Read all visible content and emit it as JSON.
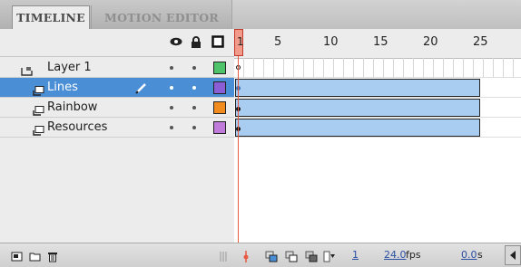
{
  "tabs": [
    {
      "label": "TIMELINE",
      "active": true
    },
    {
      "label": "MOTION EDITOR",
      "active": false
    }
  ],
  "column_icons": [
    "eye-icon",
    "lock-icon",
    "outline-icon"
  ],
  "layers": [
    {
      "name": "Layer 1",
      "icon": "folder-icon",
      "selected": false,
      "color": "#4fc36a",
      "keyframe": "hollow"
    },
    {
      "name": "Lines",
      "icon": "layer-icon",
      "selected": true,
      "color": "#8c5ed6",
      "keyframe": "filled"
    },
    {
      "name": "Rainbow",
      "icon": "layer-icon",
      "selected": false,
      "color": "#f28b1e",
      "keyframe": "filled"
    },
    {
      "name": "Resources",
      "icon": "layer-icon",
      "selected": false,
      "color": "#c07ad9",
      "keyframe": "filled"
    }
  ],
  "ruler": {
    "playhead_label": "1",
    "labels": [
      "5",
      "10",
      "15",
      "20",
      "25"
    ]
  },
  "status": {
    "current_frame": "1",
    "frame_rate": "24.0",
    "frame_rate_unit": "fps",
    "elapsed": "0.0",
    "elapsed_unit": "s"
  }
}
